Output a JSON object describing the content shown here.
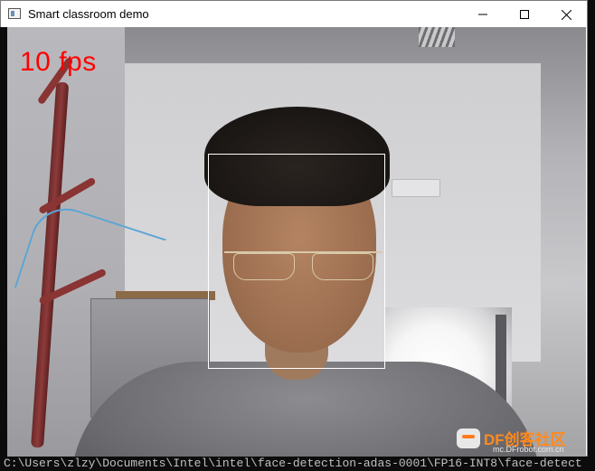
{
  "window": {
    "title": "Smart classroom demo",
    "controls": {
      "minimize": "minimize-icon",
      "maximize": "maximize-icon",
      "close": "close-icon"
    }
  },
  "video": {
    "fps_label": "10 fps",
    "fps_color": "#ff0000",
    "detection_box_color": "#ffffff"
  },
  "console": {
    "path_line": "C:\\Users\\zlzy\\Documents\\Intel\\intel\\face-detection-adas-0001\\FP16-INT8\\face-detect"
  },
  "watermark": {
    "brand": "DF创客社区",
    "url": "mc.DFrobot.com.cn"
  }
}
